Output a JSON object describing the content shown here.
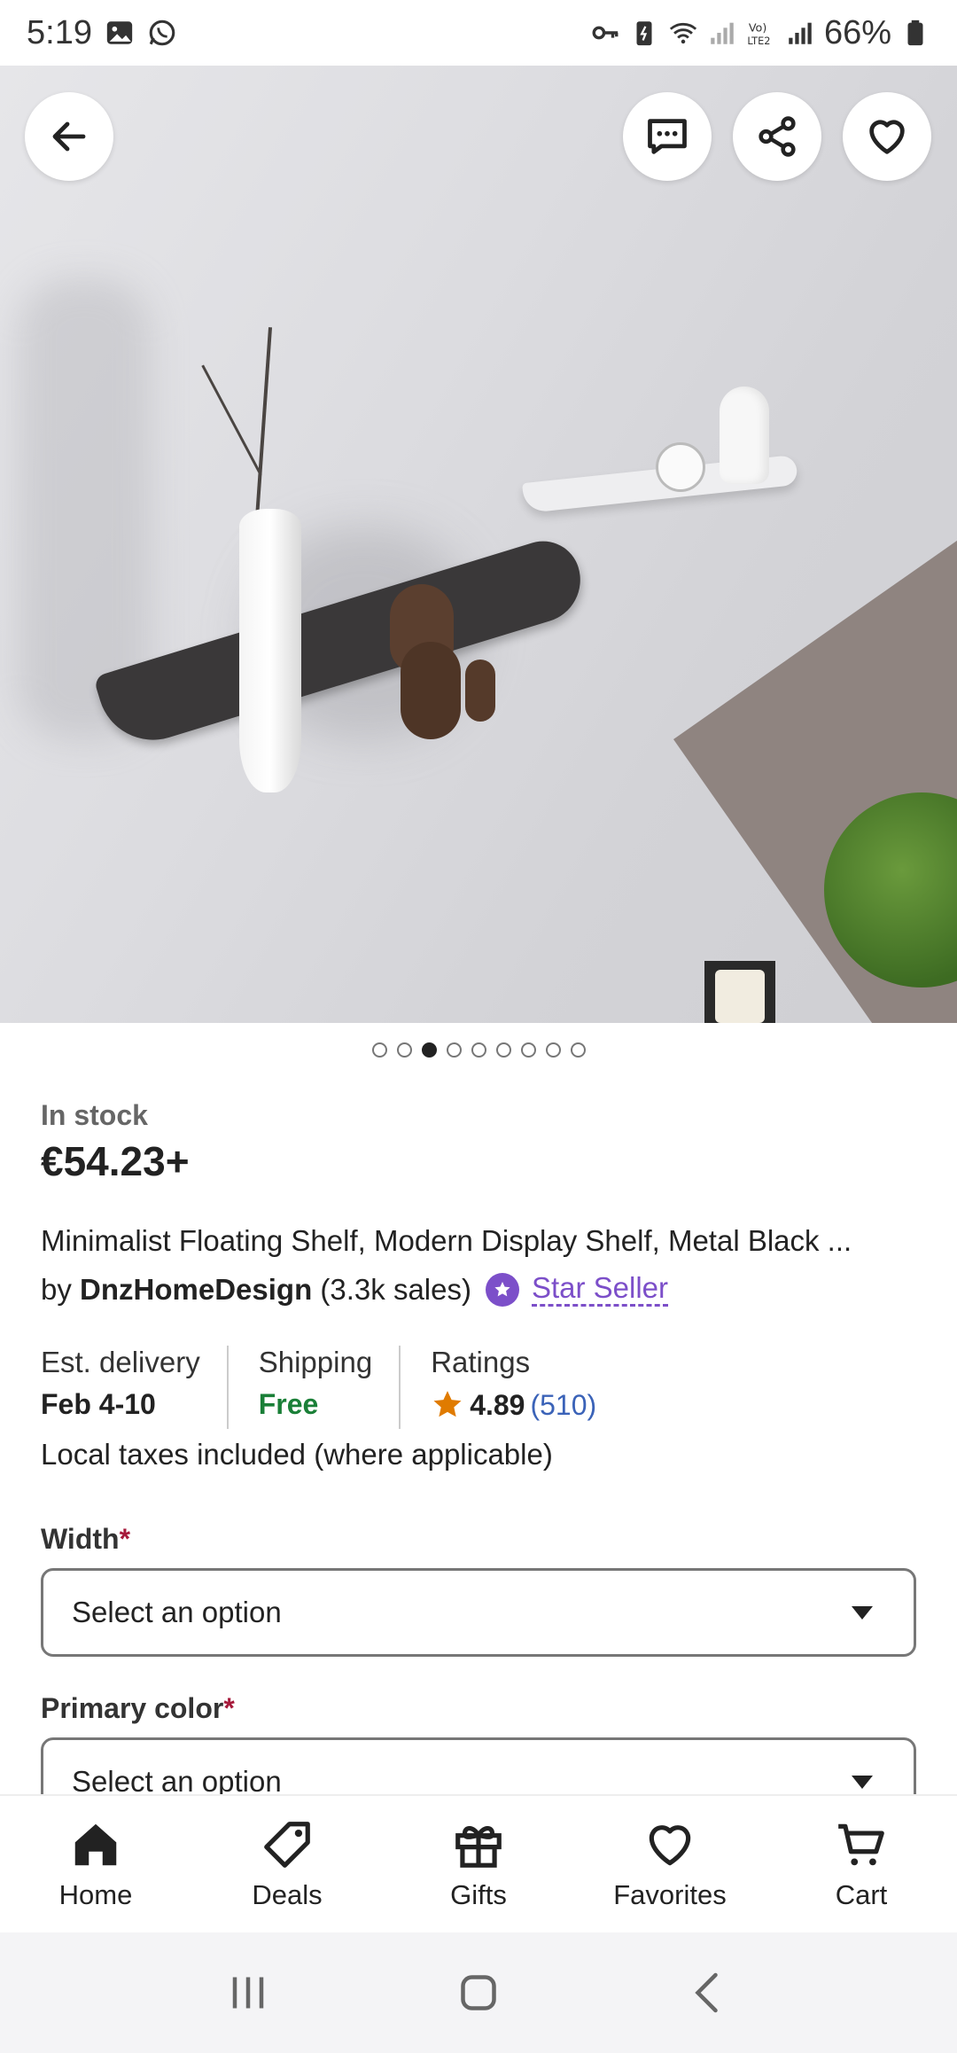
{
  "status_bar": {
    "time": "5:19",
    "battery": "66%",
    "icons": [
      "gallery-icon",
      "whatsapp-icon",
      "key-icon",
      "battery-saver-icon",
      "wifi-icon",
      "signal-icon",
      "volte-icon",
      "signal-icon",
      "battery-icon"
    ]
  },
  "hero": {
    "image_desc_icon": "product-photo",
    "dots_count": 9,
    "active_dot": 2
  },
  "product": {
    "stock": "In stock",
    "price": "€54.23+",
    "title": "Minimalist Floating Shelf, Modern Display Shelf, Metal Black ...",
    "by_label": "by",
    "shop_name": "DnzHomeDesign",
    "sales": "(3.3k sales)",
    "star_seller": "Star Seller",
    "delivery_label": "Est. delivery",
    "delivery_value": "Feb 4-10",
    "shipping_label": "Shipping",
    "shipping_value": "Free",
    "ratings_label": "Ratings",
    "rating_value": "4.89",
    "rating_count": "(510)",
    "taxes": "Local taxes included (where applicable)"
  },
  "options": {
    "width_label": "Width",
    "color_label": "Primary color",
    "required_mark": "*",
    "width_placeholder": "Select an option",
    "color_placeholder": "Select an option"
  },
  "bottom_nav": {
    "home": "Home",
    "deals": "Deals",
    "gifts": "Gifts",
    "favorites": "Favorites",
    "cart": "Cart"
  },
  "colors": {
    "accent_purple": "#7c4fc9",
    "free_green": "#1a7f37",
    "rating_star": "#e07b00",
    "link_blue": "#3b63b8"
  }
}
